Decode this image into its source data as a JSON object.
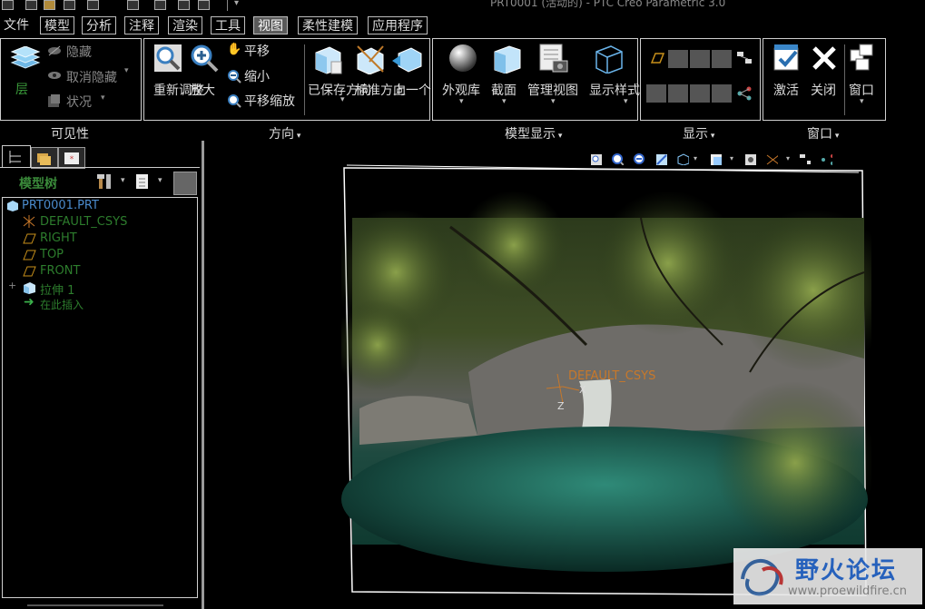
{
  "window": {
    "title": "PRT0001 (活动的) - PTC Creo Parametric 3.0"
  },
  "menu": {
    "tabs": [
      {
        "label": "文件"
      },
      {
        "label": "模型"
      },
      {
        "label": "分析"
      },
      {
        "label": "注释"
      },
      {
        "label": "渲染"
      },
      {
        "label": "工具"
      },
      {
        "label": "视图"
      },
      {
        "label": "柔性建模"
      },
      {
        "label": "应用程序"
      }
    ],
    "active": "视图"
  },
  "ribbon": {
    "visibility": {
      "group_label": "可见性",
      "layers": "层",
      "hide": "隐藏",
      "unhide": "取消隐藏",
      "status": "状况"
    },
    "orientation": {
      "group_label": "方向",
      "refit": "重新调整",
      "zoom_in": "放大",
      "pan": "平移",
      "zoom_out": "缩小",
      "pan_zoom": "平移缩放",
      "saved_orient": "已保存方向",
      "standard_orient": "标准方向",
      "previous": "上一个"
    },
    "model_display": {
      "group_label": "模型显示",
      "appearance_gallery": "外观库",
      "section": "截面",
      "manage_views": "管理视图",
      "display_style": "显示样式"
    },
    "show": {
      "group_label": "显示"
    },
    "window": {
      "group_label": "窗口",
      "activate": "激活",
      "close": "关闭",
      "windows": "窗口"
    }
  },
  "model_tree": {
    "title": "模型树",
    "items": [
      {
        "label": "PRT0001.PRT"
      },
      {
        "label": "DEFAULT_CSYS"
      },
      {
        "label": "RIGHT"
      },
      {
        "label": "TOP"
      },
      {
        "label": "FRONT"
      },
      {
        "label": "拉伸 1"
      },
      {
        "label": "在此插入"
      }
    ]
  },
  "graphics": {
    "csys_label": "DEFAULT_CSYS",
    "axis_x": "X",
    "axis_z": "Z"
  },
  "watermark": {
    "text": "野火论坛",
    "url": "www.proewildfire.cn"
  }
}
